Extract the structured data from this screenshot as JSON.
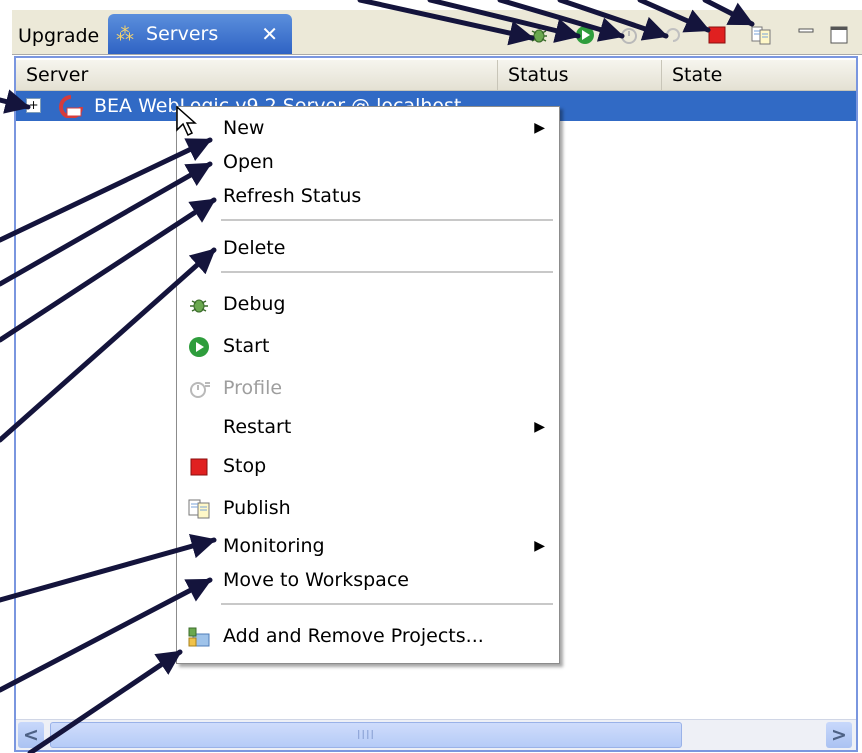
{
  "tabs": {
    "upgrade": "Upgrade",
    "servers": "Servers",
    "close_glyph": "✕"
  },
  "toolbar": {
    "icons": [
      "debug-icon",
      "start-icon",
      "profile-icon",
      "restart-icon",
      "stop-icon",
      "publish-icon",
      "minimize-icon",
      "maximize-icon"
    ]
  },
  "table": {
    "columns": [
      "Server",
      "Status",
      "State"
    ],
    "rows": [
      {
        "name": "BEA WebLogic v9.2 Server @ localhost",
        "status": "",
        "state": ""
      }
    ]
  },
  "context_menu": {
    "items": [
      {
        "label": "New",
        "submenu": true
      },
      {
        "label": "Open"
      },
      {
        "label": "Refresh Status"
      },
      {
        "label": "Delete"
      },
      {
        "label": "Debug",
        "icon": "debug-icon"
      },
      {
        "label": "Start",
        "icon": "start-icon"
      },
      {
        "label": "Profile",
        "icon": "profile-icon",
        "disabled": true
      },
      {
        "label": "Restart",
        "submenu": true
      },
      {
        "label": "Stop",
        "icon": "stop-icon"
      },
      {
        "label": "Publish",
        "icon": "publish-icon"
      },
      {
        "label": "Monitoring",
        "submenu": true
      },
      {
        "label": "Move to Workspace"
      },
      {
        "label": "Add and Remove Projects...",
        "icon": "add-remove-projects-icon"
      }
    ],
    "submenu_glyph": "▶"
  },
  "scrollbar": {
    "thumb_grip": "IIII",
    "left_glyph": "<",
    "right_glyph": ">"
  },
  "colors": {
    "selection": "#316ac5",
    "tab_active": "#3a6fd0",
    "arrow": "#14143c",
    "stop_red": "#e02020",
    "start_green": "#2e9d3c"
  }
}
